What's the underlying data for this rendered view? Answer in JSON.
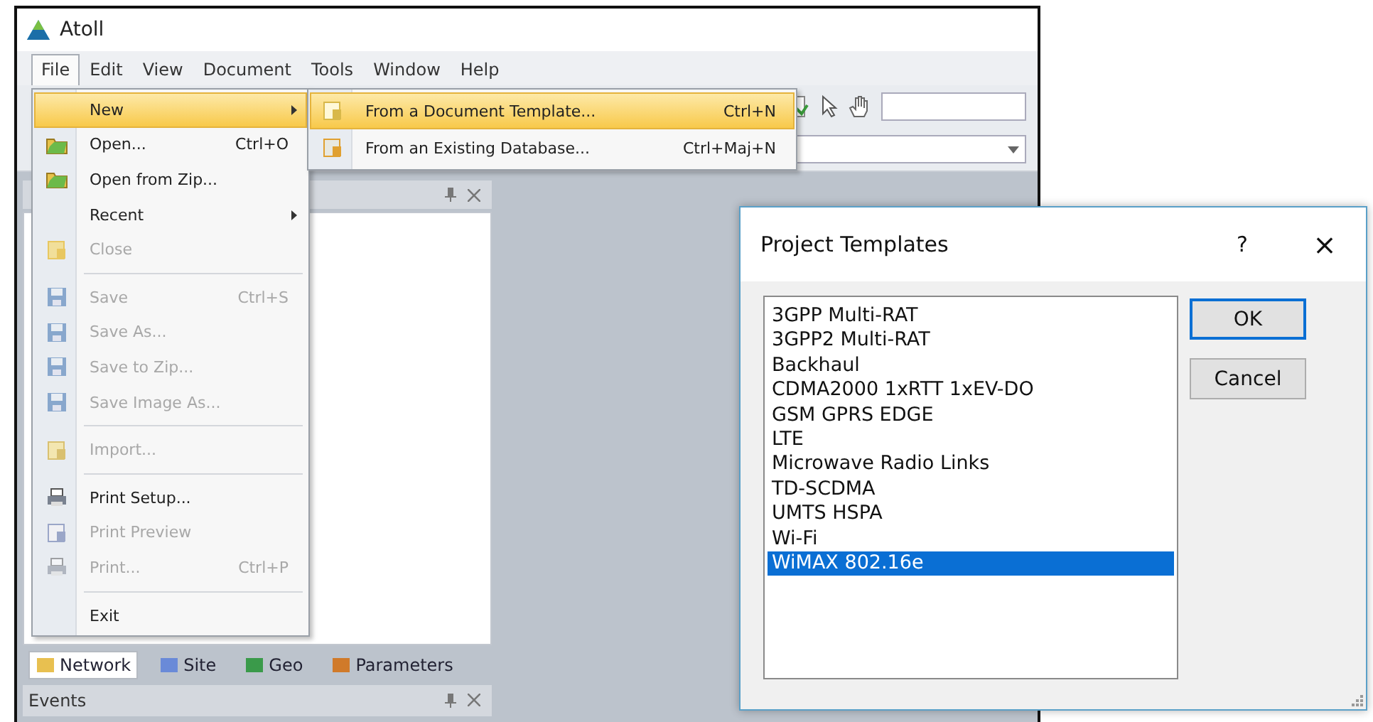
{
  "window": {
    "title": "Atoll"
  },
  "menubar": [
    {
      "label": "File",
      "selected": true
    },
    {
      "label": "Edit",
      "selected": false
    },
    {
      "label": "View",
      "selected": false
    },
    {
      "label": "Document",
      "selected": false
    },
    {
      "label": "Tools",
      "selected": false
    },
    {
      "label": "Window",
      "selected": false
    },
    {
      "label": "Help",
      "selected": false
    }
  ],
  "file_menu": [
    {
      "kind": "item",
      "label": "New",
      "submenu": true,
      "disabled": false,
      "selected": true
    },
    {
      "kind": "item",
      "label": "Open...",
      "shortcut": "Ctrl+O",
      "submenu": false,
      "disabled": false,
      "selected": false
    },
    {
      "kind": "item",
      "label": "Open from Zip...",
      "submenu": false,
      "disabled": false,
      "selected": false
    },
    {
      "kind": "item",
      "label": "Recent",
      "submenu": true,
      "disabled": false,
      "selected": false
    },
    {
      "kind": "item",
      "label": "Close",
      "submenu": false,
      "disabled": true,
      "selected": false
    },
    {
      "kind": "separator"
    },
    {
      "kind": "item",
      "label": "Save",
      "shortcut": "Ctrl+S",
      "submenu": false,
      "disabled": true,
      "selected": false
    },
    {
      "kind": "item",
      "label": "Save As...",
      "submenu": false,
      "disabled": true,
      "selected": false
    },
    {
      "kind": "item",
      "label": "Save to Zip...",
      "submenu": false,
      "disabled": true,
      "selected": false
    },
    {
      "kind": "item",
      "label": "Save Image As...",
      "submenu": false,
      "disabled": true,
      "selected": false
    },
    {
      "kind": "separator"
    },
    {
      "kind": "item",
      "label": "Import...",
      "submenu": false,
      "disabled": true,
      "selected": false
    },
    {
      "kind": "separator"
    },
    {
      "kind": "item",
      "label": "Print Setup...",
      "submenu": false,
      "disabled": false,
      "selected": false
    },
    {
      "kind": "item",
      "label": "Print Preview",
      "submenu": false,
      "disabled": true,
      "selected": false
    },
    {
      "kind": "item",
      "label": "Print...",
      "shortcut": "Ctrl+P",
      "submenu": false,
      "disabled": true,
      "selected": false
    },
    {
      "kind": "separator"
    },
    {
      "kind": "item",
      "label": "Exit",
      "submenu": false,
      "disabled": false,
      "selected": false
    }
  ],
  "new_submenu": [
    {
      "label": "From a Document Template...",
      "shortcut": "Ctrl+N",
      "selected": true
    },
    {
      "label": "From an Existing Database...",
      "shortcut": "Ctrl+Maj+N",
      "selected": false
    }
  ],
  "left_panel": {
    "tabs": [
      {
        "label": "Network",
        "selected": true
      },
      {
        "label": "Site",
        "selected": false
      },
      {
        "label": "Geo",
        "selected": false
      },
      {
        "label": "Parameters",
        "selected": false
      }
    ],
    "bottom_panel": {
      "title": "Events"
    }
  },
  "dialog": {
    "title": "Project Templates",
    "help": "?",
    "close": "×",
    "items": [
      {
        "label": "3GPP Multi-RAT",
        "selected": false
      },
      {
        "label": "3GPP2 Multi-RAT",
        "selected": false
      },
      {
        "label": "Backhaul",
        "selected": false
      },
      {
        "label": "CDMA2000 1xRTT 1xEV-DO",
        "selected": false
      },
      {
        "label": "GSM GPRS EDGE",
        "selected": false
      },
      {
        "label": "LTE",
        "selected": false
      },
      {
        "label": "Microwave Radio Links",
        "selected": false
      },
      {
        "label": "TD-SCDMA",
        "selected": false
      },
      {
        "label": "UMTS HSPA",
        "selected": false
      },
      {
        "label": "Wi-Fi",
        "selected": false
      },
      {
        "label": "WiMAX 802.16e",
        "selected": true
      }
    ],
    "buttons": [
      {
        "label": "OK",
        "default": true
      },
      {
        "label": "Cancel",
        "default": false
      }
    ]
  }
}
